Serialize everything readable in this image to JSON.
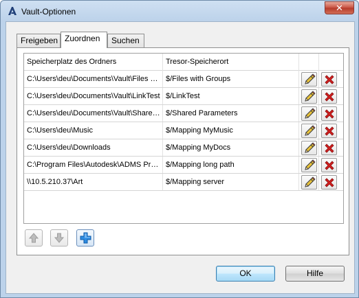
{
  "window": {
    "title": "Vault-Optionen",
    "close_symbol": "✕"
  },
  "tabs": [
    {
      "label": "Freigeben",
      "active": false
    },
    {
      "label": "Zuordnen",
      "active": true
    },
    {
      "label": "Suchen",
      "active": false
    }
  ],
  "grid": {
    "columns": [
      "Speicherplatz des Ordners",
      "Tresor-Speicherort",
      "",
      ""
    ],
    "rows": [
      {
        "folder": "C:\\Users\\deu\\Documents\\Vault\\Files with Groups",
        "vault": "$/Files with Groups"
      },
      {
        "folder": "C:\\Users\\deu\\Documents\\Vault\\LinkTest",
        "vault": "$/LinkTest"
      },
      {
        "folder": "C:\\Users\\deu\\Documents\\Vault\\Shared Parameters",
        "vault": "$/Shared Parameters"
      },
      {
        "folder": "C:\\Users\\deu\\Music",
        "vault": "$/Mapping MyMusic"
      },
      {
        "folder": "C:\\Users\\deu\\Downloads",
        "vault": "$/Mapping MyDocs"
      },
      {
        "folder": "C:\\Program Files\\Autodesk\\ADMS Professional",
        "vault": "$/Mapping long path"
      },
      {
        "folder": "\\\\10.5.210.37\\Art",
        "vault": "$/Mapping server"
      }
    ],
    "row_icons": {
      "edit": "pencil-icon",
      "delete": "red-x-icon"
    }
  },
  "toolbar": {
    "move_up": "arrow-up-icon",
    "move_down": "arrow-down-icon",
    "add": "plus-icon"
  },
  "buttons": {
    "ok": "OK",
    "help": "Hilfe"
  },
  "colors": {
    "title_bar": "#bcd2ea",
    "close_button": "#c7503f",
    "delete_icon": "#d11f1f",
    "add_icon": "#1a7ad6"
  }
}
